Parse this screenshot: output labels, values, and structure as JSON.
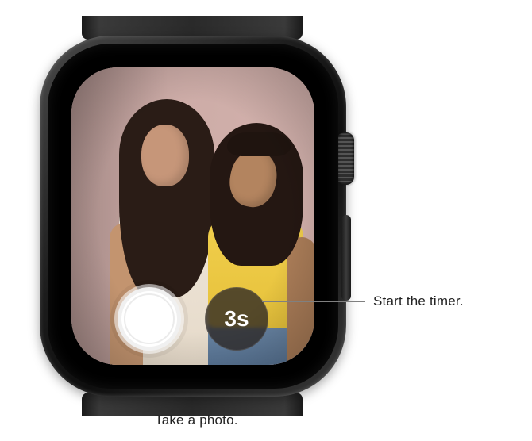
{
  "controls": {
    "timer_label": "3s"
  },
  "callouts": {
    "shutter": "Take a photo.",
    "timer": "Start the timer."
  }
}
